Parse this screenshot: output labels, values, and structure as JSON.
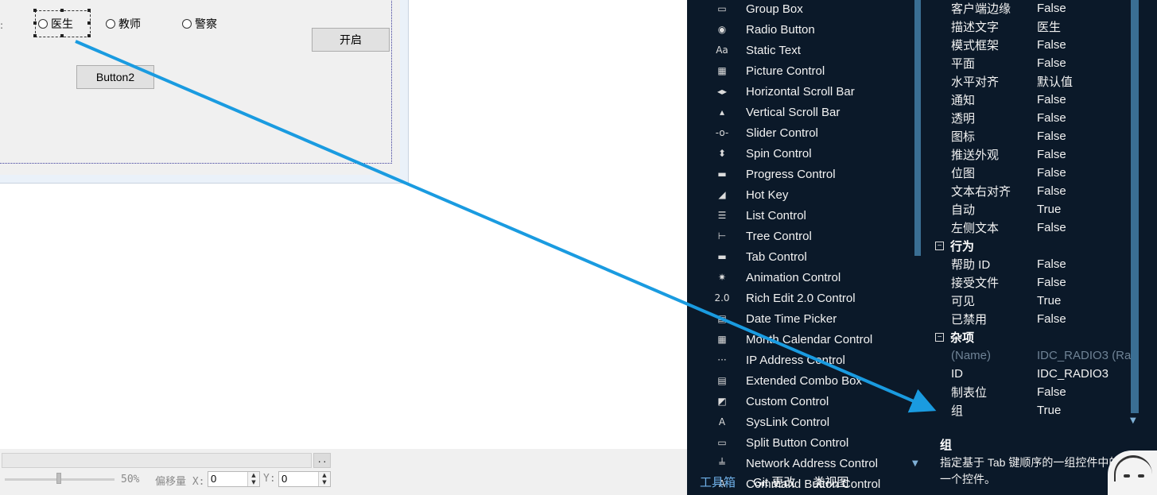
{
  "dialog": {
    "radios": [
      {
        "label": "医生"
      },
      {
        "label": "教师"
      },
      {
        "label": "警察"
      }
    ],
    "buttons": {
      "open": "开启",
      "button2": "Button2"
    }
  },
  "status": {
    "ellipsis": "..",
    "zoom": "50%",
    "offset_x_label": "偏移量 X:",
    "offset_x": "0",
    "offset_y_label": "Y:",
    "offset_y": "0"
  },
  "toolbox": {
    "items": [
      {
        "label": "Group Box",
        "icon": "group-box-icon",
        "glyph": "▭"
      },
      {
        "label": "Radio Button",
        "icon": "radio-button-icon",
        "glyph": "◉"
      },
      {
        "label": "Static Text",
        "icon": "static-text-icon",
        "glyph": "Aa"
      },
      {
        "label": "Picture Control",
        "icon": "picture-control-icon",
        "glyph": "▦"
      },
      {
        "label": "Horizontal Scroll Bar",
        "icon": "hscroll-icon",
        "glyph": "◂▸"
      },
      {
        "label": "Vertical Scroll Bar",
        "icon": "vscroll-icon",
        "glyph": "▴"
      },
      {
        "label": "Slider Control",
        "icon": "slider-icon",
        "glyph": "-o-"
      },
      {
        "label": "Spin Control",
        "icon": "spin-icon",
        "glyph": "⬍"
      },
      {
        "label": "Progress Control",
        "icon": "progress-icon",
        "glyph": "▬"
      },
      {
        "label": "Hot Key",
        "icon": "hot-key-icon",
        "glyph": "◢"
      },
      {
        "label": "List Control",
        "icon": "list-control-icon",
        "glyph": "☰"
      },
      {
        "label": "Tree Control",
        "icon": "tree-control-icon",
        "glyph": "⊢"
      },
      {
        "label": "Tab Control",
        "icon": "tab-control-icon",
        "glyph": "▬"
      },
      {
        "label": "Animation Control",
        "icon": "animation-icon",
        "glyph": "✷"
      },
      {
        "label": "Rich Edit 2.0 Control",
        "icon": "rich-edit-icon",
        "glyph": "2.0"
      },
      {
        "label": "Date Time Picker",
        "icon": "date-time-picker-icon",
        "glyph": "▤"
      },
      {
        "label": "Month Calendar Control",
        "icon": "month-calendar-icon",
        "glyph": "▦"
      },
      {
        "label": "IP Address Control",
        "icon": "ip-address-icon",
        "glyph": "···"
      },
      {
        "label": "Extended Combo Box",
        "icon": "extended-combo-icon",
        "glyph": "▤"
      },
      {
        "label": "Custom Control",
        "icon": "custom-control-icon",
        "glyph": "◩"
      },
      {
        "label": "SysLink Control",
        "icon": "syslink-icon",
        "glyph": "A"
      },
      {
        "label": "Split Button Control",
        "icon": "split-button-icon",
        "glyph": "▭"
      },
      {
        "label": "Network Address Control",
        "icon": "network-address-icon",
        "glyph": "╧"
      },
      {
        "label": "Command Button Control",
        "icon": "command-button-icon",
        "glyph": "A"
      }
    ],
    "tabs": [
      "工具箱",
      "Git 更改",
      "类视图"
    ]
  },
  "properties": {
    "rows": [
      {
        "kind": "prop",
        "key": "客户端边缘",
        "value": "False"
      },
      {
        "kind": "prop",
        "key": "描述文字",
        "value": "医生"
      },
      {
        "kind": "prop",
        "key": "模式框架",
        "value": "False"
      },
      {
        "kind": "prop",
        "key": "平面",
        "value": "False"
      },
      {
        "kind": "prop",
        "key": "水平对齐",
        "value": "默认值"
      },
      {
        "kind": "prop",
        "key": "通知",
        "value": "False"
      },
      {
        "kind": "prop",
        "key": "透明",
        "value": "False"
      },
      {
        "kind": "prop",
        "key": "图标",
        "value": "False"
      },
      {
        "kind": "prop",
        "key": "推送外观",
        "value": "False"
      },
      {
        "kind": "prop",
        "key": "位图",
        "value": "False"
      },
      {
        "kind": "prop",
        "key": "文本右对齐",
        "value": "False"
      },
      {
        "kind": "prop",
        "key": "自动",
        "value": "True"
      },
      {
        "kind": "prop",
        "key": "左侧文本",
        "value": "False"
      },
      {
        "kind": "cat",
        "key": "行为"
      },
      {
        "kind": "prop",
        "key": "帮助 ID",
        "value": "False"
      },
      {
        "kind": "prop",
        "key": "接受文件",
        "value": "False"
      },
      {
        "kind": "prop",
        "key": "可见",
        "value": "True"
      },
      {
        "kind": "prop",
        "key": "已禁用",
        "value": "False"
      },
      {
        "kind": "cat",
        "key": "杂项"
      },
      {
        "kind": "prop",
        "key": "(Name)",
        "value": "IDC_RADIO3 (Ra",
        "dim": true
      },
      {
        "kind": "prop",
        "key": "ID",
        "value": "IDC_RADIO3"
      },
      {
        "kind": "prop",
        "key": "制表位",
        "value": "False"
      },
      {
        "kind": "prop",
        "key": "组",
        "value": "True"
      }
    ],
    "description": {
      "title": "组",
      "text": "指定基于 Tab 键顺序的一组控件中的第一个控件。"
    }
  },
  "colors": {
    "arrow": "#1a9be0",
    "panel_bg": "#0b1929",
    "accent_tab": "#6fb0e8"
  }
}
